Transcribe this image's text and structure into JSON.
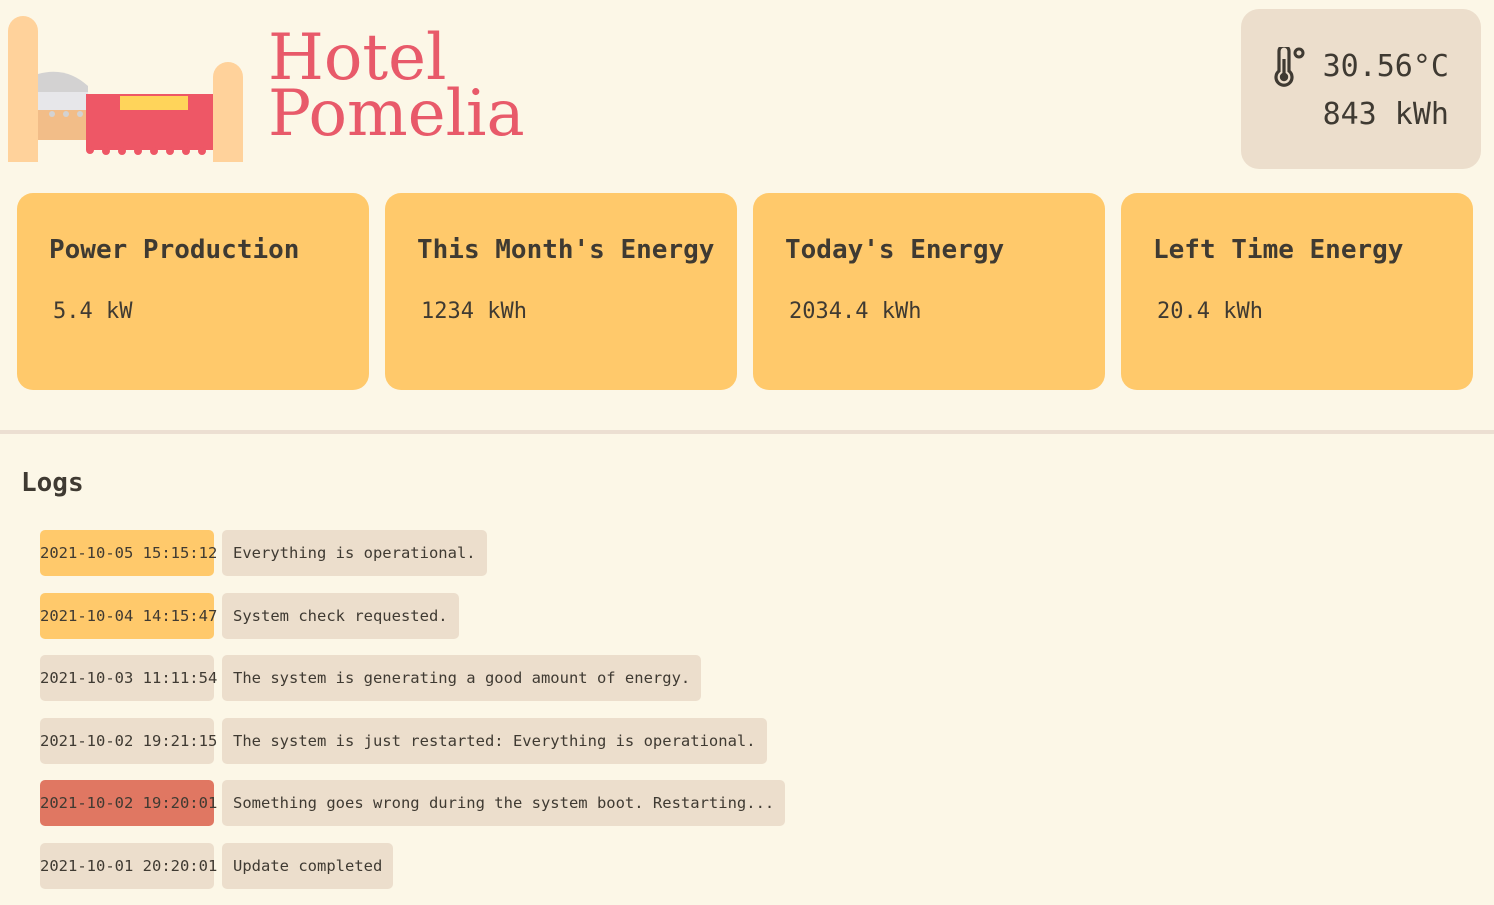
{
  "brand": {
    "line1": "Hotel",
    "line2": "Pomelia",
    "logo_icon": "bed-icon"
  },
  "weather": {
    "icon": "thermometer-icon",
    "temperature": "30.56°C",
    "energy": "843 kWh"
  },
  "cards": [
    {
      "title": "Power Production",
      "value": "5.4 kW"
    },
    {
      "title": "This Month's Energy",
      "value": "1234 kWh"
    },
    {
      "title": "Today's Energy",
      "value": "2034.4 kWh"
    },
    {
      "title": "Left Time Energy",
      "value": "20.4 kWh"
    }
  ],
  "logs": {
    "title": "Logs",
    "items": [
      {
        "time": "2021-10-05 15:15:12",
        "message": "Everything is operational.",
        "level": "ok"
      },
      {
        "time": "2021-10-04 14:15:47",
        "message": "System check requested.",
        "level": "ok"
      },
      {
        "time": "2021-10-03 11:11:54",
        "message": "The system is generating a good amount of energy.",
        "level": "info"
      },
      {
        "time": "2021-10-02 19:21:15",
        "message": "The system is just restarted: Everything is operational.",
        "level": "info"
      },
      {
        "time": "2021-10-02 19:20:01",
        "message": "Something goes wrong during the system boot. Restarting...",
        "level": "err"
      },
      {
        "time": "2021-10-01 20:20:01",
        "message": "Update completed",
        "level": "info"
      }
    ]
  },
  "colors": {
    "background": "#fcf7e7",
    "brand": "#e85a6a",
    "card": "#ffc96b",
    "panel": "#ecdecc",
    "error": "#e07762",
    "text": "#3f3a32"
  }
}
